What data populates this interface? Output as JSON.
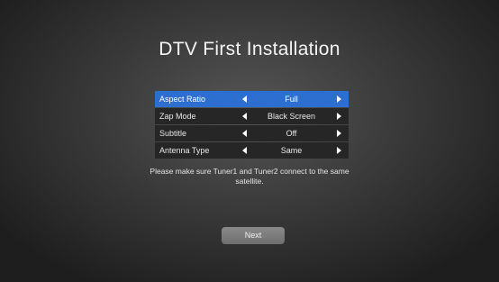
{
  "page": {
    "title": "DTV First Installation"
  },
  "settings": [
    {
      "label": "Aspect Ratio",
      "value": "Full",
      "selected": true
    },
    {
      "label": "Zap Mode",
      "value": "Black Screen",
      "selected": false
    },
    {
      "label": "Subtitle",
      "value": "Off",
      "selected": false
    },
    {
      "label": "Antenna Type",
      "value": "Same",
      "selected": false
    }
  ],
  "note": {
    "text": "Please make sure Tuner1 and Tuner2 connect to the same satellite."
  },
  "next": {
    "label": "Next"
  },
  "icons": {
    "left": "arrow-left-icon",
    "right": "arrow-right-icon"
  },
  "colors": {
    "selected_row": "#2c6fd1",
    "row": "#262626",
    "button": "#7c7c7c"
  }
}
